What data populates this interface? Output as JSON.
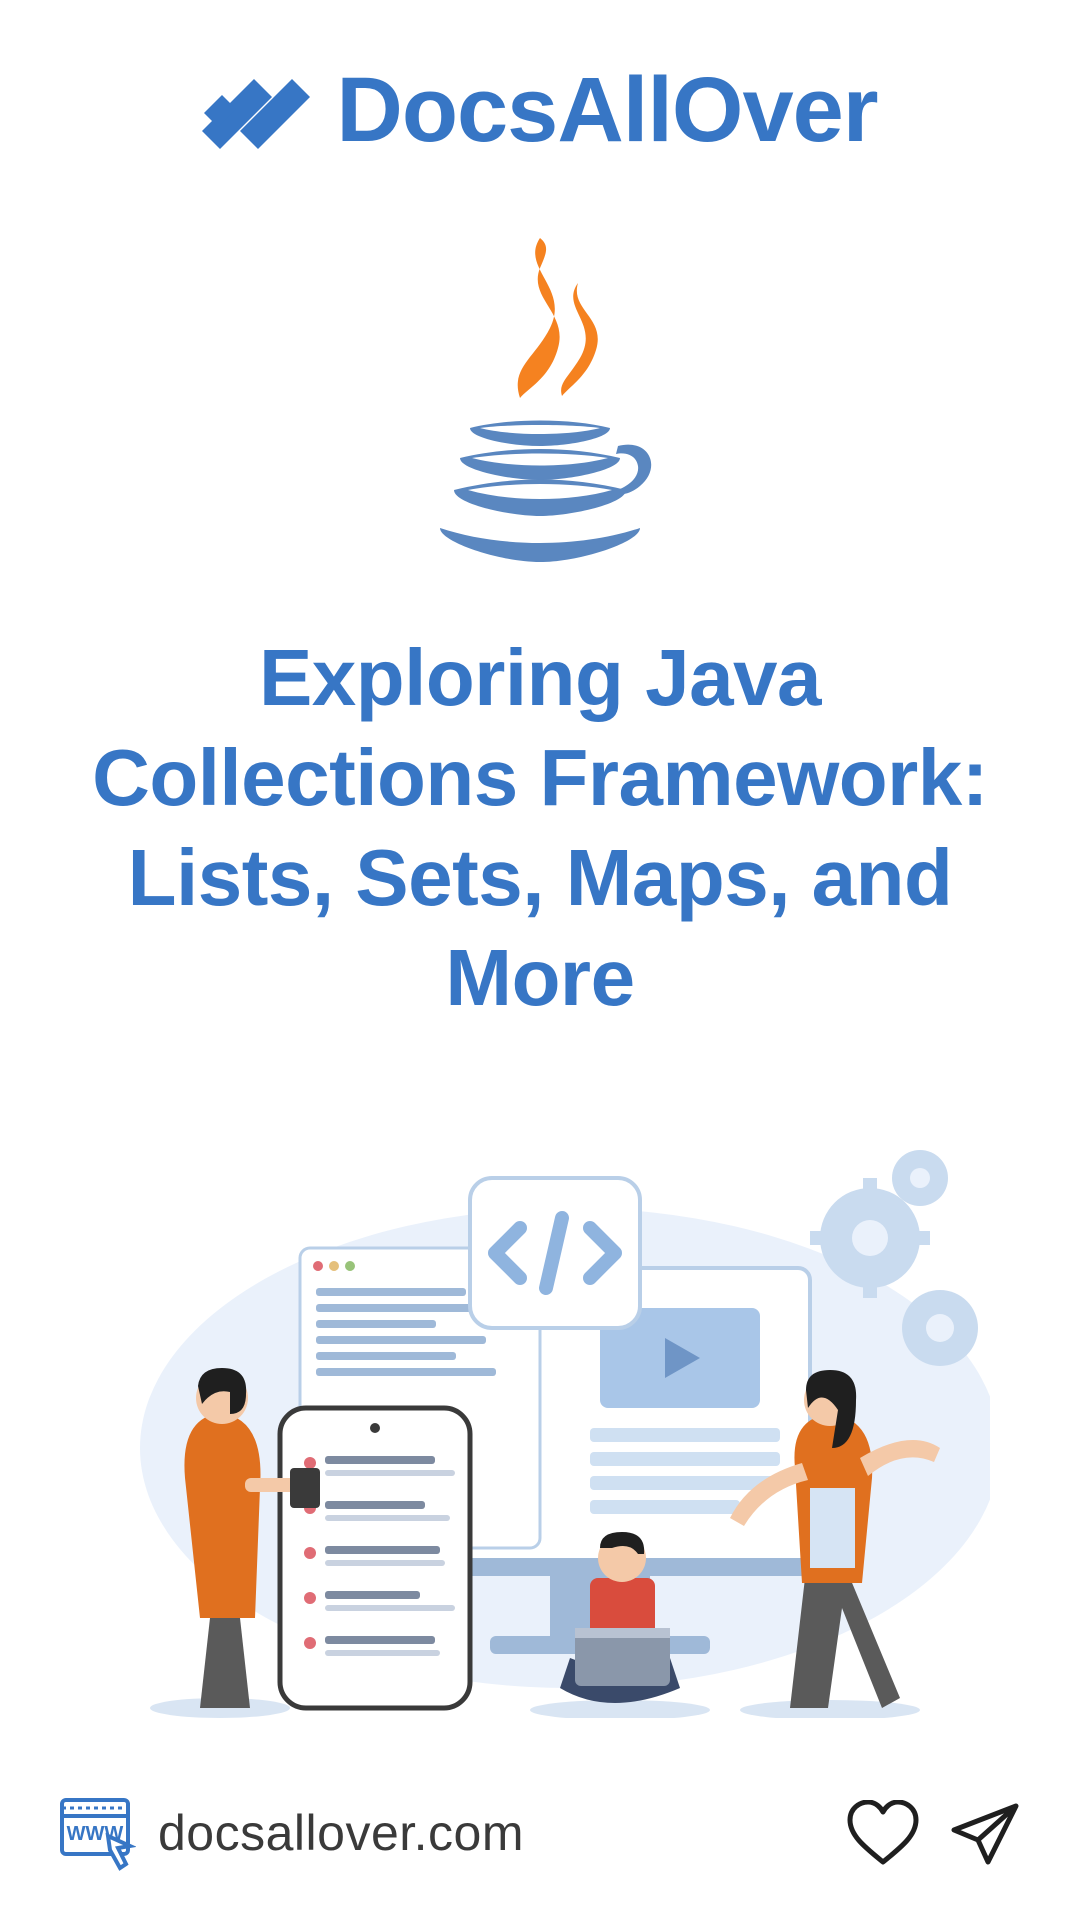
{
  "brand": "DocsAllOver",
  "title": "Exploring Java Collections Framework: Lists, Sets, Maps, and More",
  "url": "docsallover.com",
  "colors": {
    "primary": "#3776c5",
    "orange": "#f58220",
    "cup": "#5a87c0",
    "text": "#3a3a3a"
  },
  "icons": {
    "logo": "slashes-icon",
    "center": "java-icon",
    "website": "browser-www-icon",
    "like": "heart-icon",
    "share": "paper-plane-icon"
  }
}
